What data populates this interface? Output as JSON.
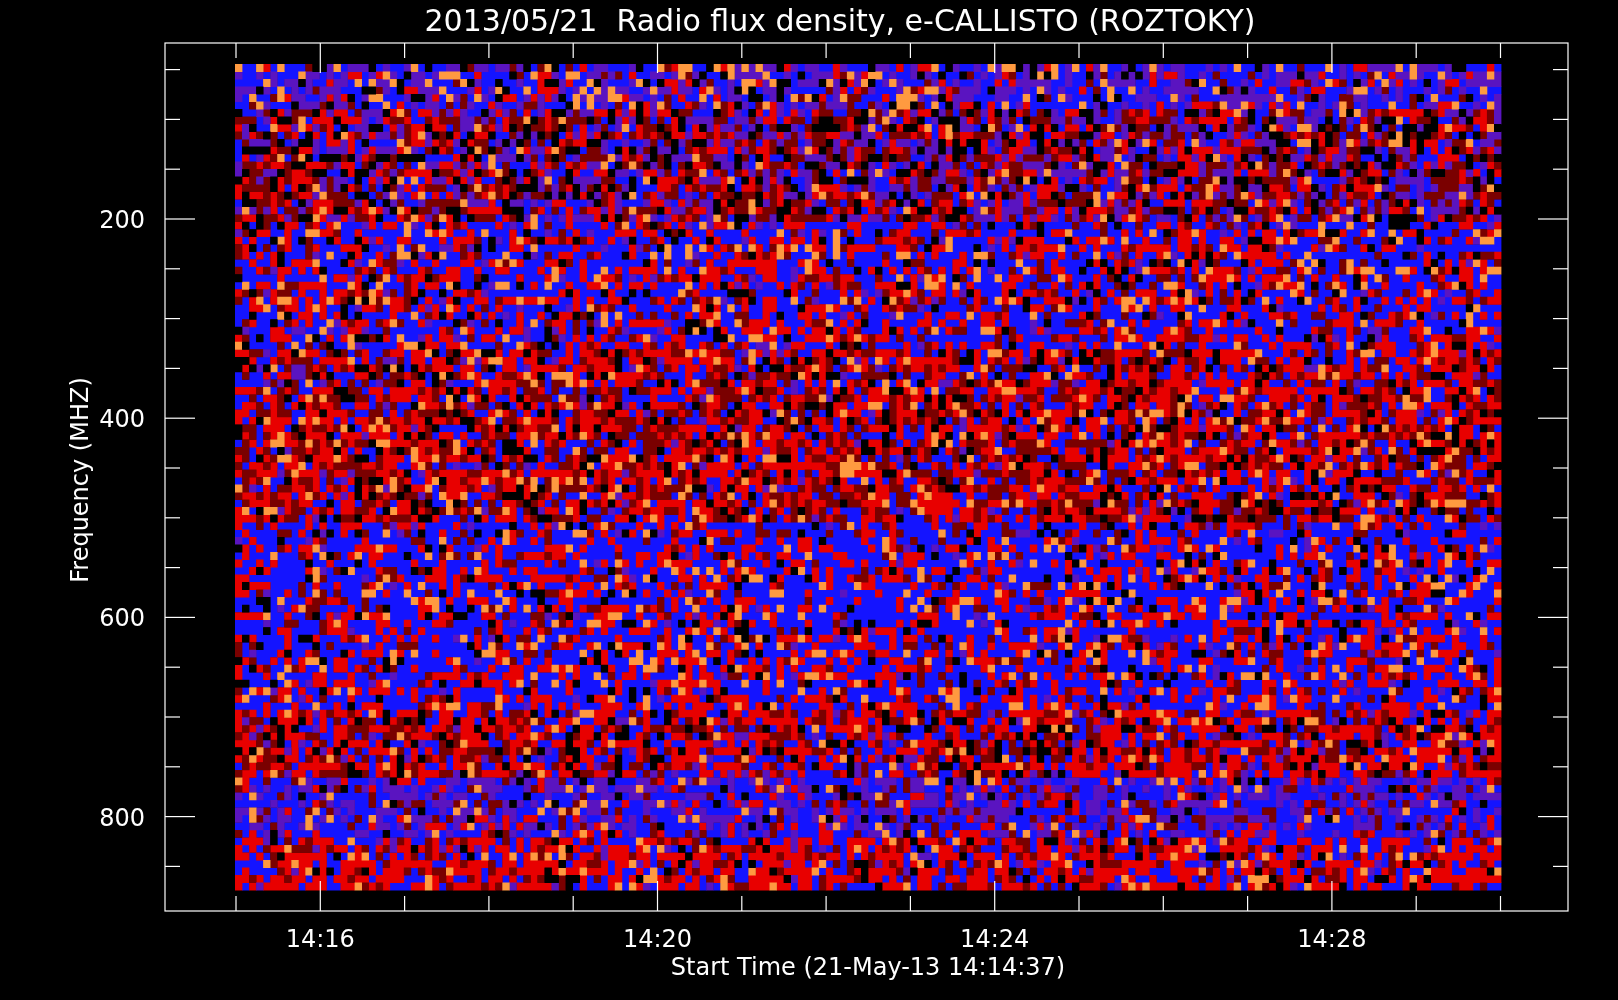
{
  "title": "2013/05/21  Radio flux density, e-CALLISTO (ROZTOKY)",
  "y_axis": {
    "label": "Frequency (MHZ)",
    "ticks": [
      "200",
      "400",
      "600",
      "800"
    ]
  },
  "x_axis": {
    "label": "Start Time (21-May-13 14:14:37)",
    "ticks": [
      "14:16",
      "14:20",
      "14:24",
      "14:28"
    ]
  }
}
